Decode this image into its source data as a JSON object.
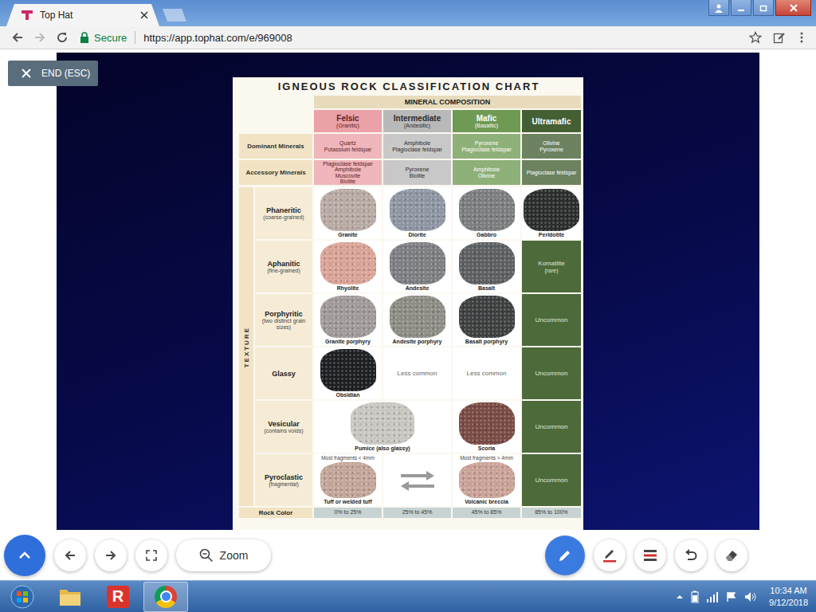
{
  "browser": {
    "tab_title": "Top Hat",
    "secure_label": "Secure",
    "url": "https://app.tophat.com/e/969008"
  },
  "presentation": {
    "end_button": "END (ESC)"
  },
  "chart": {
    "title": "IGNEOUS ROCK CLASSIFICATION CHART",
    "composition_label": "MINERAL COMPOSITION",
    "dominant_label": "Dominant Minerals",
    "accessory_label": "Accessory Minerals",
    "texture_label": "TEXTURE",
    "columns": [
      {
        "name": "Felsic",
        "sub": "(Granitic)",
        "color": "#eba1a8",
        "text_color": "#5a1f25",
        "dominant": [
          "Quartz",
          "Potassium feldspar"
        ],
        "accessory": [
          "Plagioclase feldspar",
          "Amphibole",
          "Muscovite",
          "Biotite"
        ]
      },
      {
        "name": "Intermediate",
        "sub": "(Andesitic)",
        "color": "#b9b9b9",
        "text_color": "#2b2b2b",
        "dominant": [
          "Amphibole",
          "Plagioclase feldspar"
        ],
        "accessory": [
          "Pyroxene",
          "Biotite"
        ]
      },
      {
        "name": "Mafic",
        "sub": "(Basaltic)",
        "color": "#6e9a53",
        "text_color": "#ffffff",
        "dominant": [
          "Pyroxene",
          "Plagioclase feldspar"
        ],
        "accessory": [
          "Amphibole",
          "Olivine"
        ]
      },
      {
        "name": "Ultramafic",
        "sub": "",
        "color": "#435f33",
        "text_color": "#ffffff",
        "dominant": [
          "Olivine",
          "Pyroxene"
        ],
        "accessory": [
          "Plagioclase feldspar"
        ]
      }
    ],
    "textures": [
      {
        "name": "Phaneritic",
        "sub": "(coarse-grained)",
        "cells": [
          {
            "kind": "rock",
            "name": "Granite",
            "color": "#b9aaa3",
            "note": ""
          },
          {
            "kind": "rock",
            "name": "Diorite",
            "color": "#8e96a3",
            "note": ""
          },
          {
            "kind": "rock",
            "name": "Gabbro",
            "color": "#7b7f80",
            "note": ""
          },
          {
            "kind": "rock",
            "name": "Peridotite",
            "color": "#2a2e2c",
            "note": ""
          }
        ]
      },
      {
        "name": "Aphanitic",
        "sub": "(fine-grained)",
        "cells": [
          {
            "kind": "rock",
            "name": "Rhyolite",
            "color": "#dba397",
            "note": ""
          },
          {
            "kind": "rock",
            "name": "Andesite",
            "color": "#7d7f83",
            "note": ""
          },
          {
            "kind": "rock",
            "name": "Basalt",
            "color": "#5d6062",
            "note": ""
          },
          {
            "kind": "uncommon",
            "name": "Komatiite",
            "sub": "(rare)"
          }
        ]
      },
      {
        "name": "Porphyritic",
        "sub": "(two distinct grain sizes)",
        "cells": [
          {
            "kind": "rock",
            "name": "Granite porphyry",
            "color": "#a09a98",
            "note": ""
          },
          {
            "kind": "rock",
            "name": "Andesite porphyry",
            "color": "#8d8c85",
            "note": ""
          },
          {
            "kind": "rock",
            "name": "Basalt porphyry",
            "color": "#3d4040",
            "note": ""
          },
          {
            "kind": "uncommon",
            "name": "Uncommon",
            "sub": ""
          }
        ]
      },
      {
        "name": "Glassy",
        "sub": "",
        "cells": [
          {
            "kind": "rock",
            "name": "Obsidian",
            "color": "#1e1f22",
            "note": ""
          },
          {
            "kind": "note",
            "name": "Less common",
            "sub": ""
          },
          {
            "kind": "note",
            "name": "Less common",
            "sub": ""
          },
          {
            "kind": "uncommon",
            "name": "Uncommon",
            "sub": ""
          }
        ]
      },
      {
        "name": "Vesicular",
        "sub": "(contains voids)",
        "cells": [
          {
            "kind": "rock-wide",
            "name": "Pumice (also glassy)",
            "color": "#c9c6c2",
            "note": ""
          },
          {
            "kind": "rock",
            "name": "Scoria",
            "color": "#7a4a44",
            "note": ""
          },
          {
            "kind": "uncommon",
            "name": "Uncommon",
            "sub": ""
          }
        ]
      },
      {
        "name": "Pyroclastic",
        "sub": "(fragmental)",
        "cells": [
          {
            "kind": "rock",
            "name": "Tuff or welded tuff",
            "color": "#c4a59a",
            "note": "Most fragments < 4mm"
          },
          {
            "kind": "arrows",
            "name": "",
            "sub": ""
          },
          {
            "kind": "rock",
            "name": "Volcanic breccia",
            "color": "#cba297",
            "note": "Most fragments > 4mm"
          },
          {
            "kind": "uncommon",
            "name": "Uncommon",
            "sub": ""
          }
        ]
      }
    ],
    "rock_color": {
      "label": "Rock Color",
      "values": [
        "0% to 25%",
        "25% to 45%",
        "45% to 85%",
        "85% to 100%"
      ]
    }
  },
  "toolbar": {
    "zoom": "Zoom"
  },
  "taskbar": {
    "r_app_glyph": "R",
    "time": "10:34 AM",
    "date": "9/12/2018"
  }
}
